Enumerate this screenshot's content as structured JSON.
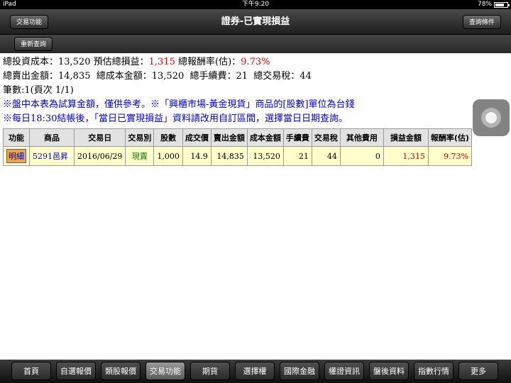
{
  "status_bar": {
    "device": "iPad",
    "time": "下午9:20",
    "battery": "78%",
    "battery_level": 0.78
  },
  "nav": {
    "title": "證券-已實現損益",
    "left_button": "交易功能",
    "right_button": "查詢條件",
    "refresh_button": "重新查詢"
  },
  "summary": {
    "line1_a": "總投資成本：13,520",
    "line1_b": "預估總損益：",
    "line1_b_val": "1,315",
    "line1_c": "總報酬率(估)：",
    "line1_c_val": "9.73%",
    "line2": "總賣出金額：14,835  總成本金額：13,520  總手續費：21  總交易稅：44",
    "line3": "筆數:1(頁次 1/1)",
    "note1": "※盤中本表為試算金額，僅供參考。※「興櫃市場-黃金現貨」商品的[股數]單位為台錢",
    "note2": "※每日18:30結帳後，「當日已實現損益」資料請改用自訂區間，選擇當日日期查詢。"
  },
  "table": {
    "headers": [
      "功能",
      "商品",
      "交易日",
      "交易別",
      "股數",
      "成交價",
      "賣出金額",
      "成本金額",
      "手續費",
      "交易稅",
      "其他費用",
      "損益金額",
      "報酬率(估)"
    ],
    "rows": [
      {
        "action": "明細",
        "product": "5291邑昇",
        "date": "2016/06/29",
        "type": "現賣",
        "shares": "1,000",
        "price": "14.9",
        "sell_amount": "14,835",
        "cost_amount": "13,520",
        "fee": "21",
        "tax": "44",
        "other_fee": "0",
        "profit": "1,315",
        "return_rate": "9.73%"
      }
    ]
  },
  "tabs": [
    {
      "label": "首頁"
    },
    {
      "label": "自選報價"
    },
    {
      "label": "類股報價"
    },
    {
      "label": "交易功能"
    },
    {
      "label": "期貨"
    },
    {
      "label": "選擇權"
    },
    {
      "label": "國際金融"
    },
    {
      "label": "權證資訊"
    },
    {
      "label": "盤後資料"
    },
    {
      "label": "指數行情"
    },
    {
      "label": "更多"
    }
  ],
  "active_tab": "交易功能"
}
